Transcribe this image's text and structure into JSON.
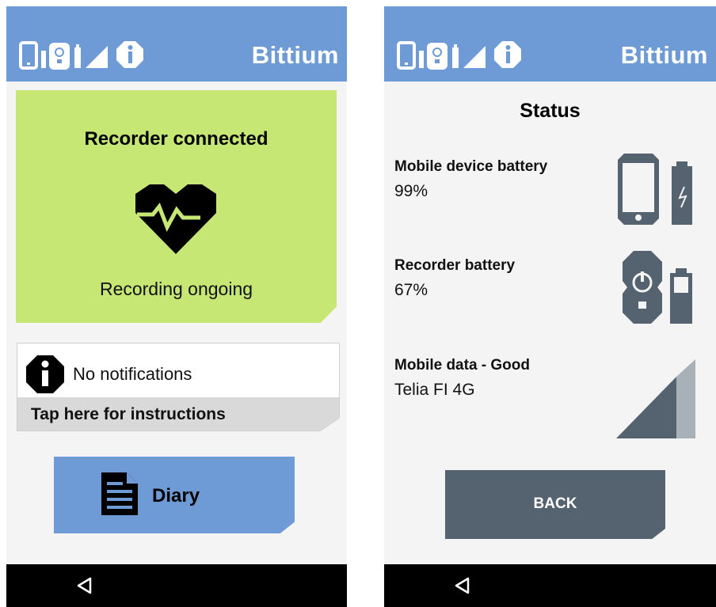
{
  "brand": "Bittium",
  "colors": {
    "header": "#6e9bd6",
    "card_green": "#c6e774",
    "icon_slate": "#556270",
    "back_button": "#556270"
  },
  "status_bar_icons": [
    "phone-icon",
    "recorder-icon",
    "battery-icon",
    "signal-icon",
    "info-icon"
  ],
  "left": {
    "recorder_card": {
      "title": "Recorder connected",
      "icon": "heart-ecg-icon",
      "status": "Recording ongoing"
    },
    "notifications": {
      "icon": "info-icon",
      "text": "No notifications",
      "instructions": "Tap here for instructions"
    },
    "diary_button": {
      "icon": "document-icon",
      "label": "Diary"
    }
  },
  "right": {
    "title": "Status",
    "rows": [
      {
        "label": "Mobile device battery",
        "value": "99%",
        "icon": "phone-battery-icon"
      },
      {
        "label": "Recorder battery",
        "value": "67%",
        "icon": "recorder-battery-icon"
      },
      {
        "label": "Mobile data - Good",
        "value": "Telia FI 4G",
        "icon": "signal-strength-icon"
      }
    ],
    "back_button": {
      "label": "BACK"
    }
  },
  "navbar": {
    "icon": "back-triangle-icon"
  }
}
